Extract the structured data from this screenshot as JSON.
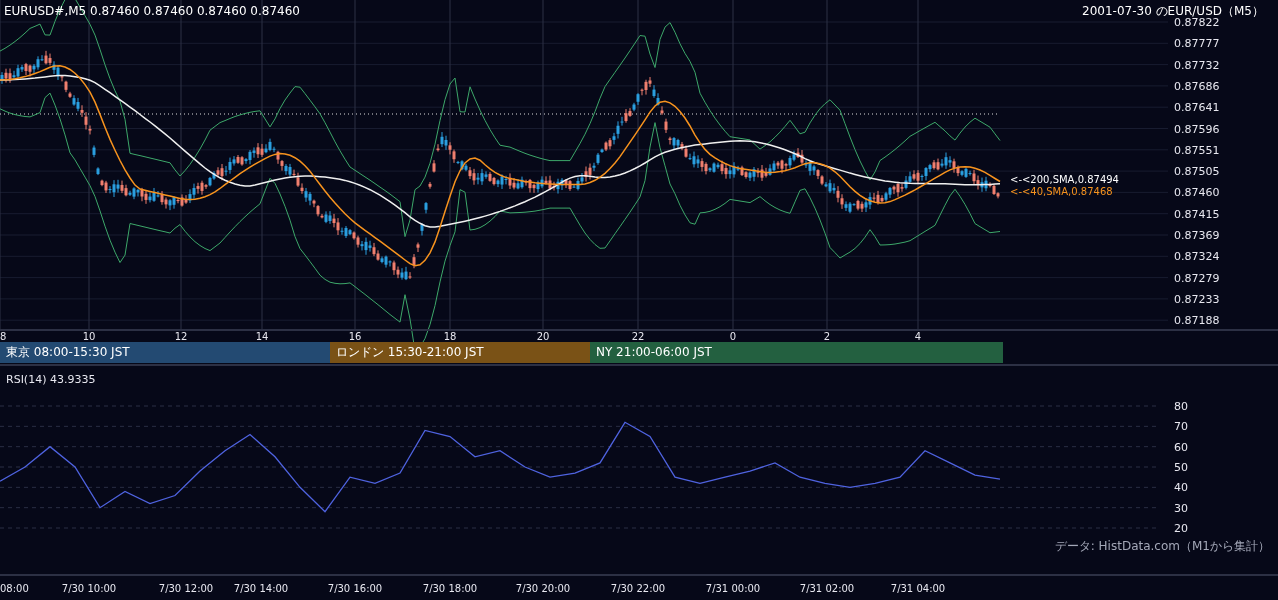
{
  "header": {
    "quote": "EURUSD#,M5 0.87460 0.87460 0.87460 0.87460",
    "title": "2001-07-30 のEUR/USD（M5）"
  },
  "price_axis": [
    "0.87822",
    "0.87777",
    "0.87732",
    "0.87686",
    "0.87641",
    "0.87596",
    "0.87551",
    "0.87505",
    "0.87460",
    "0.87415",
    "0.87369",
    "0.87324",
    "0.87279",
    "0.87233",
    "0.87188"
  ],
  "sma_labels": [
    {
      "text": "<-<200,SMA,0.87494",
      "color": "#ffffff"
    },
    {
      "text": "<-<40,SMA,0.87468",
      "color": "#f7931e"
    }
  ],
  "hour_labels": [
    "8",
    "10",
    "12",
    "14",
    "16",
    "18",
    "20",
    "22",
    "0",
    "2",
    "4"
  ],
  "sessions": [
    {
      "label": "東京 08:00-15:30 JST",
      "color": "#234a72"
    },
    {
      "label": "ロンドン 15:30-21:00 JST",
      "color": "#7a5216"
    },
    {
      "label": "NY 21:00-06:00 JST",
      "color": "#236040"
    }
  ],
  "rsi": {
    "reading": "43.9335",
    "chart_data": {
      "type": "line",
      "ylim": [
        20,
        80
      ],
      "grid": true,
      "yticks": [
        20,
        30,
        40,
        50,
        60,
        70,
        80
      ],
      "series": [
        {
          "name": "RSI(14)",
          "color": "#4f63e0",
          "values": [
            43,
            50,
            60,
            50,
            30,
            38,
            32,
            36,
            48,
            58,
            66,
            55,
            40,
            28,
            45,
            42,
            47,
            68,
            65,
            55,
            58,
            50,
            45,
            47,
            52,
            72,
            65,
            45,
            42,
            45,
            48,
            52,
            45,
            42,
            40,
            42,
            45,
            58,
            52,
            46,
            44
          ]
        }
      ]
    }
  },
  "credit": "データ: HistData.com（M1から集計）",
  "time_labels": [
    "08:00",
    "7/30 10:00",
    "7/30 12:00",
    "7/30 14:00",
    "7/30 16:00",
    "7/30 18:00",
    "7/30 20:00",
    "7/30 22:00",
    "7/31 00:00",
    "7/31 02:00",
    "7/31 04:00"
  ]
}
